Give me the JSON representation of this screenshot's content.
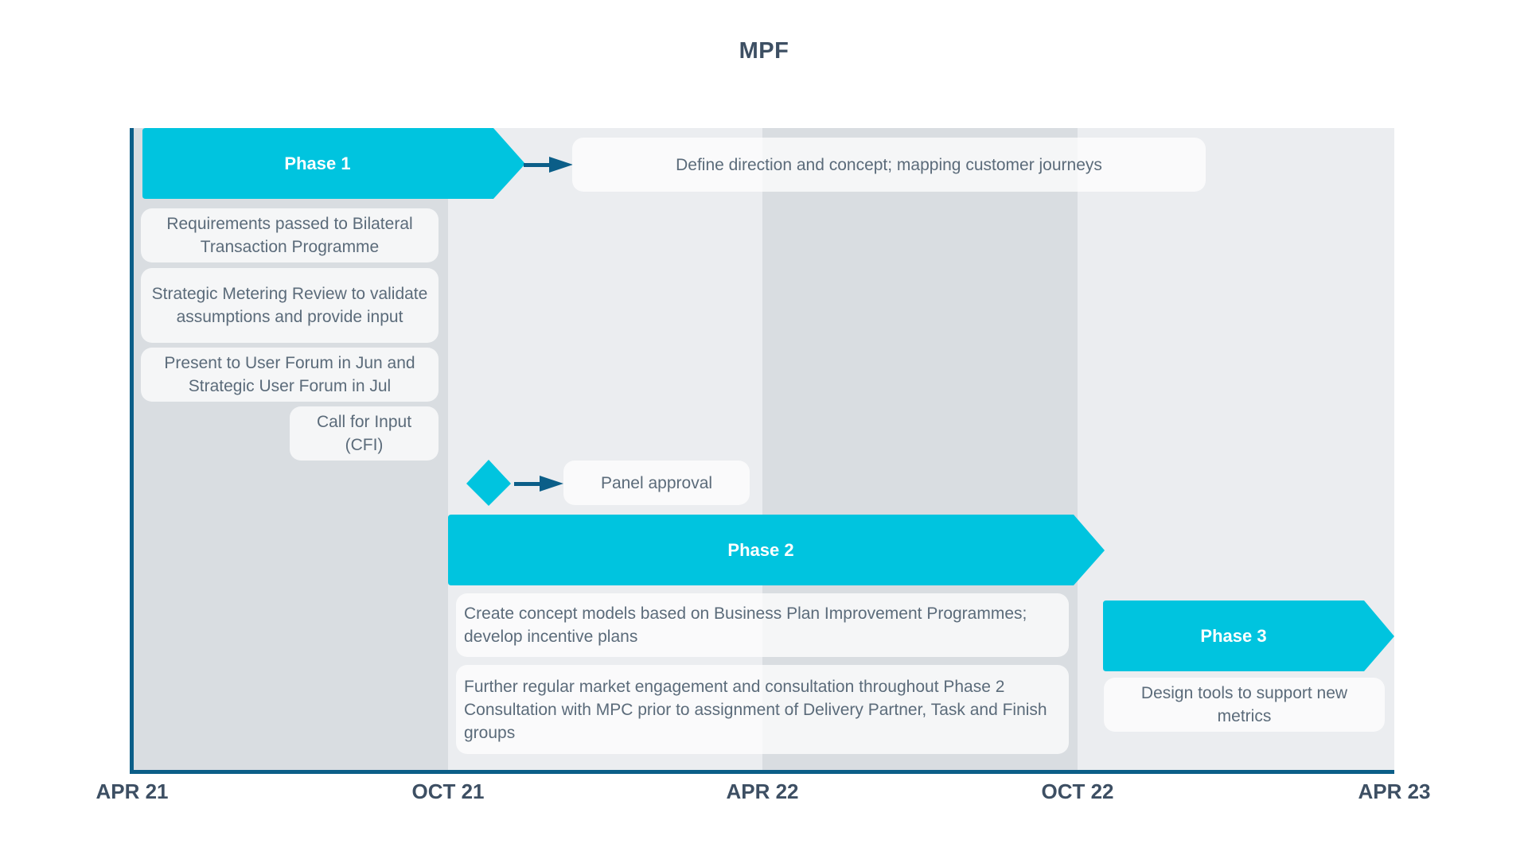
{
  "title": "MPF",
  "colors": {
    "phase": "#00c4df",
    "axis": "#0b5e88",
    "band_dark": "#d9dde1",
    "band_light": "#ebedf0",
    "text": "#5b6b7a",
    "title_text": "#3d4f63"
  },
  "axis": {
    "ticks": [
      "APR 21",
      "OCT 21",
      "APR 22",
      "OCT 22",
      "APR 23"
    ]
  },
  "phases": [
    {
      "label": "Phase 1",
      "start": "APR 21",
      "end": "OCT 21"
    },
    {
      "label": "Phase 2",
      "start": "OCT 21",
      "end": "OCT 22"
    },
    {
      "label": "Phase 3",
      "start": "OCT 22",
      "end": "APR 23"
    }
  ],
  "notes": {
    "phase1_arrow_note": "Define direction and concept; mapping customer journeys",
    "requirements": "Requirements passed to Bilateral Transaction Programme",
    "strategic_review": "Strategic Metering Review to validate assumptions and provide input",
    "user_forum": "Present to User Forum in Jun and Strategic User Forum in Jul",
    "cfi": "Call for Input (CFI)",
    "milestone": "Panel approval",
    "phase2_note1": "Create concept models based on Business Plan Improvement Programmes; develop incentive plans",
    "phase2_note2_line1": "Further regular market engagement and consultation throughout Phase 2",
    "phase2_note2_line2": "Consultation with MPC prior to assignment of Delivery Partner, Task and Finish groups",
    "phase3_note": "Design tools to support new metrics"
  }
}
